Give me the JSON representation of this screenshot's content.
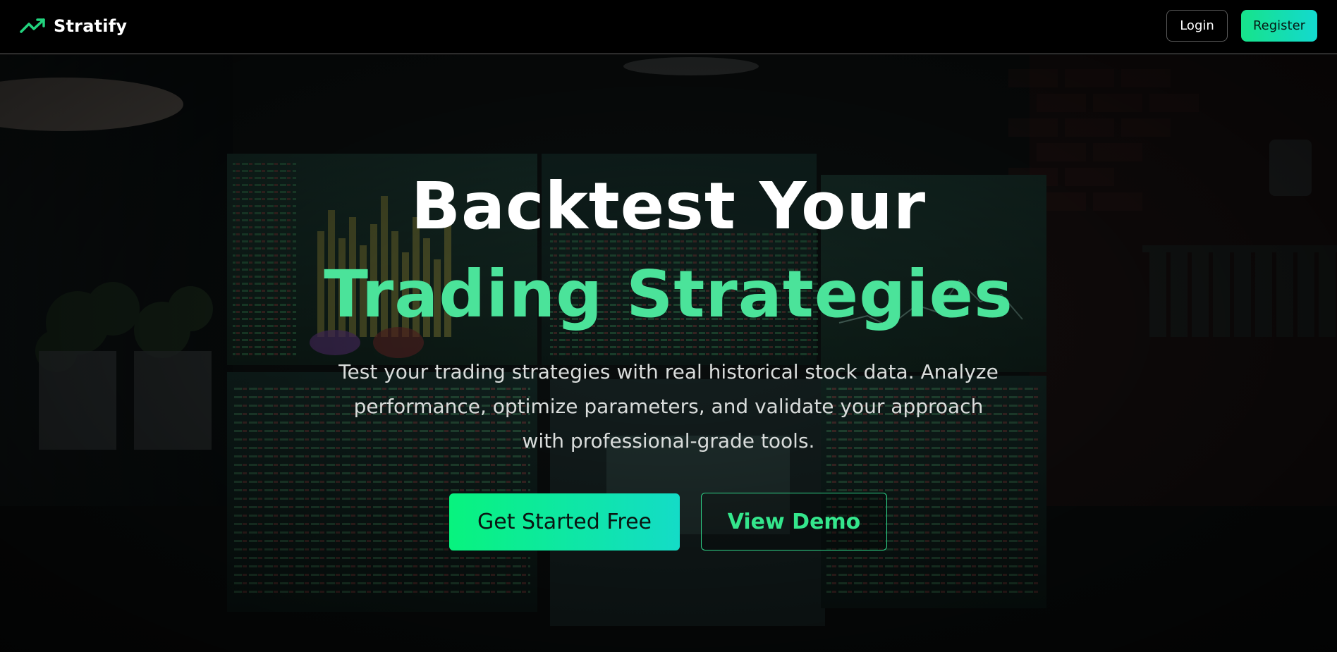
{
  "header": {
    "brand_name": "Stratify",
    "brand_icon": "trending-up-icon",
    "login_label": "Login",
    "register_label": "Register"
  },
  "hero": {
    "background_image": "trading-desk-monitors-photo",
    "headline_line1": "Backtest Your",
    "headline_line2": "Trading Strategies",
    "subtitle": "Test your trading strategies with real historical stock data. Analyze performance, optimize parameters, and validate your approach with professional-grade tools.",
    "primary_cta": "Get Started Free",
    "secondary_cta": "View Demo"
  },
  "colors": {
    "accent_green": "#4be39a",
    "gradient_start": "#08f37e",
    "gradient_end": "#14dcc7",
    "background": "#000000",
    "header_border": "#6e6e6e"
  }
}
